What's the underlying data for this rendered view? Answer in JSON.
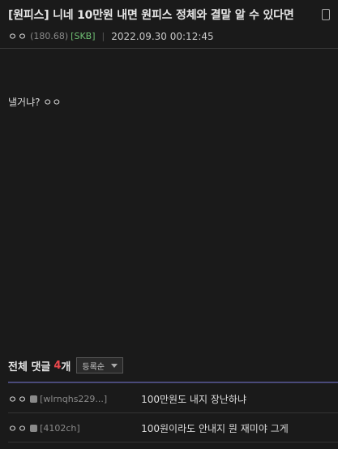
{
  "post": {
    "title": "[원피스] 니네 10만원 내면 원피스 정체와 결말 알 수 있다면",
    "author": {
      "nick": "ㅇㅇ",
      "ip": "(180.68)",
      "tag": "[SKB]"
    },
    "date": "2022.09.30 00:12:45",
    "body": "낼거냐? ㅇㅇ"
  },
  "comments": {
    "title": "전체 댓글",
    "count": "4",
    "unit": "개",
    "sort": {
      "selected": "등록순"
    },
    "items": [
      {
        "nick": "ㅇㅇ",
        "id": "[wlrnqhs229...]",
        "text": "100만원도 내지 장난하냐"
      },
      {
        "nick": "ㅇㅇ",
        "id": "[4102ch]",
        "text": "100원이라도 안내지 뭔 재미야 그게"
      }
    ]
  },
  "colors": {
    "background": "#1a1a1a",
    "count_accent": "#e8474c",
    "tag_green": "#6fbf73"
  }
}
